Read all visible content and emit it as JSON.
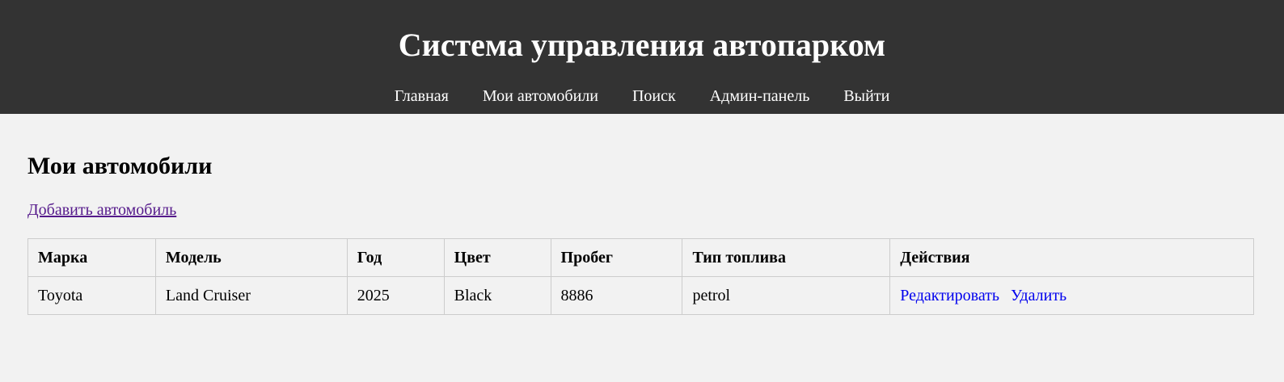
{
  "header": {
    "title": "Система управления автопарком",
    "nav": [
      "Главная",
      "Мои автомобили",
      "Поиск",
      "Админ-панель",
      "Выйти"
    ]
  },
  "main": {
    "heading": "Мои автомобили",
    "add_link": "Добавить автомобиль",
    "table": {
      "columns": [
        "Марка",
        "Модель",
        "Год",
        "Цвет",
        "Пробег",
        "Тип топлива",
        "Действия"
      ],
      "rows": [
        {
          "brand": "Toyota",
          "model": "Land Cruiser",
          "year": "2025",
          "color": "Black",
          "mileage": "8886",
          "fuel": "petrol",
          "actions": [
            "Редактировать",
            "Удалить"
          ]
        }
      ]
    }
  },
  "colors": {
    "header_bg": "#333333",
    "page_bg": "#f2f2f2",
    "visited_link": "#551a8b",
    "link": "#0000ee"
  }
}
